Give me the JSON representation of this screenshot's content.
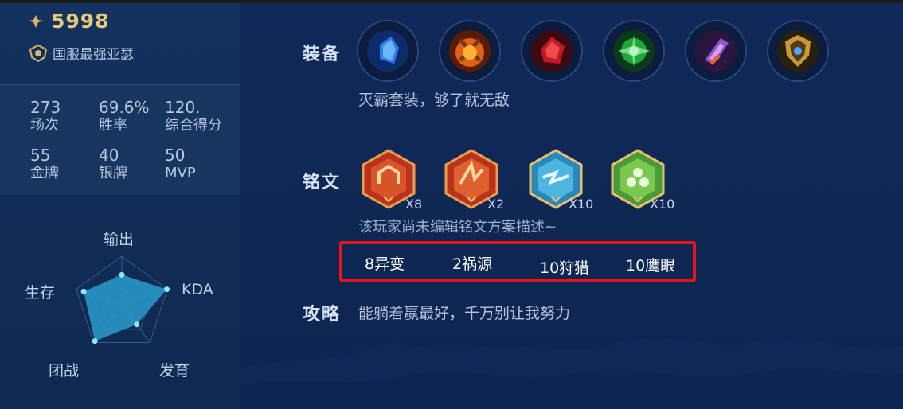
{
  "profile": {
    "score": "5998",
    "title": "国服最强亚瑟"
  },
  "stats": [
    {
      "value": "273",
      "label": "场次"
    },
    {
      "value": "69.6%",
      "label": "胜率"
    },
    {
      "value": "120.",
      "label": "综合得分"
    },
    {
      "value": "55",
      "label": "金牌"
    },
    {
      "value": "40",
      "label": "银牌"
    },
    {
      "value": "50",
      "label": "MVP"
    }
  ],
  "radar": {
    "labels": {
      "top": "输出",
      "right": "KDA",
      "bottom_right": "发育",
      "bottom_left": "团战",
      "left": "生存"
    },
    "values": {
      "top": 0.61,
      "right": 0.99,
      "bottom_right": 0.53,
      "bottom_left": 0.96,
      "left": 0.84
    },
    "fill_color": "#2a9ccc",
    "dot_color": "#8fe6ff"
  },
  "equipment": {
    "title": "装备",
    "items": [
      "blue-crystal-icon",
      "fire-armor-icon",
      "red-crystal-icon",
      "green-gem-icon",
      "purple-blade-icon",
      "golden-shield-icon"
    ],
    "description": "灭霸套装，够了就无敌"
  },
  "runes": {
    "title": "铭文",
    "items": [
      {
        "icon": "red-rune-icon",
        "count": "X8"
      },
      {
        "icon": "red-rune-icon",
        "count": "X2"
      },
      {
        "icon": "blue-rune-icon",
        "count": "X10"
      },
      {
        "icon": "green-rune-icon",
        "count": "X10"
      }
    ],
    "description": "该玩家尚未编辑铭文方案描述~",
    "annotations": [
      "8异变",
      "2祸源",
      "10狩猎",
      "10鹰眼"
    ]
  },
  "strategy": {
    "title": "攻略",
    "text": "能躺着赢最好，千万别让我努力"
  },
  "colors": {
    "accent_gold": "#e8c67a",
    "highlight_red": "#e8141b"
  }
}
